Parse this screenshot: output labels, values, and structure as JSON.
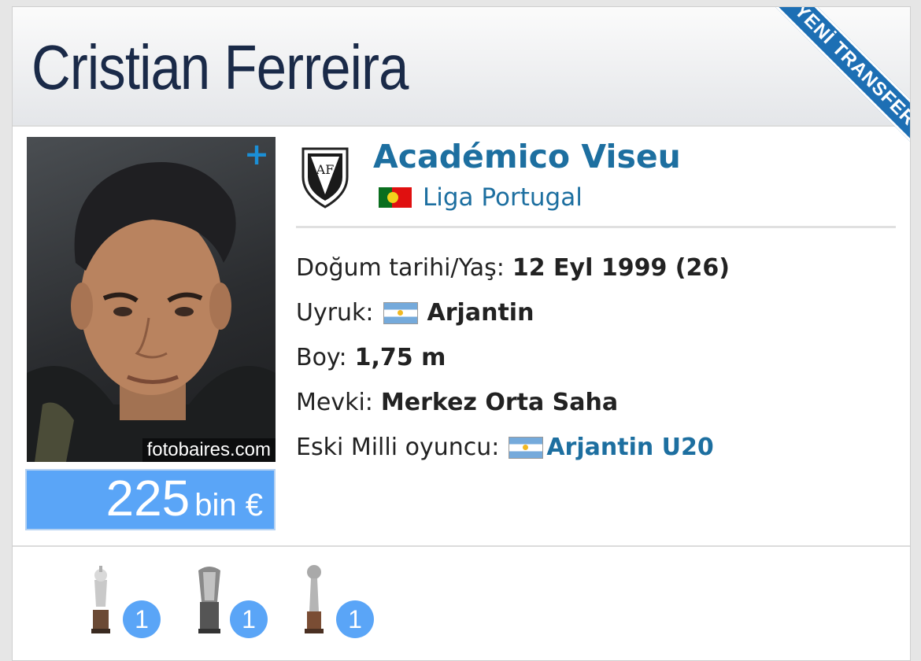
{
  "player": {
    "name": "Cristian Ferreira",
    "badge": "YENİ TRANSFER",
    "photo_credit": "fotobaires.com",
    "photo_plus": "+",
    "market_value": {
      "amount": "225",
      "unit": "bin €"
    }
  },
  "club": {
    "name": "Académico Viseu",
    "league": "Liga Portugal",
    "league_flag": "portugal-flag-icon"
  },
  "details": [
    {
      "label": "Doğum tarihi/Yaş:",
      "value": "12 Eyl 1999 (26)"
    },
    {
      "label": "Uyruk:",
      "value": "Arjantin",
      "flag": "argentina-flag-icon"
    },
    {
      "label": "Boy:",
      "value": "1,75 m"
    },
    {
      "label": "Mevki:",
      "value": "Merkez Orta Saha"
    },
    {
      "label": "Eski Milli oyuncu:",
      "value": "Arjantin U20",
      "flag": "argentina-flag-icon",
      "link": true
    }
  ],
  "trophies": [
    {
      "icon": "trophy-cup-icon",
      "count": "1"
    },
    {
      "icon": "trophy-cup-icon",
      "count": "1"
    },
    {
      "icon": "trophy-cup-icon",
      "count": "1"
    }
  ],
  "colors": {
    "accent": "#1d6fa0",
    "value_box": "#5aa5f7",
    "ribbon": "#1d6fb4",
    "name": "#1a2a48"
  }
}
